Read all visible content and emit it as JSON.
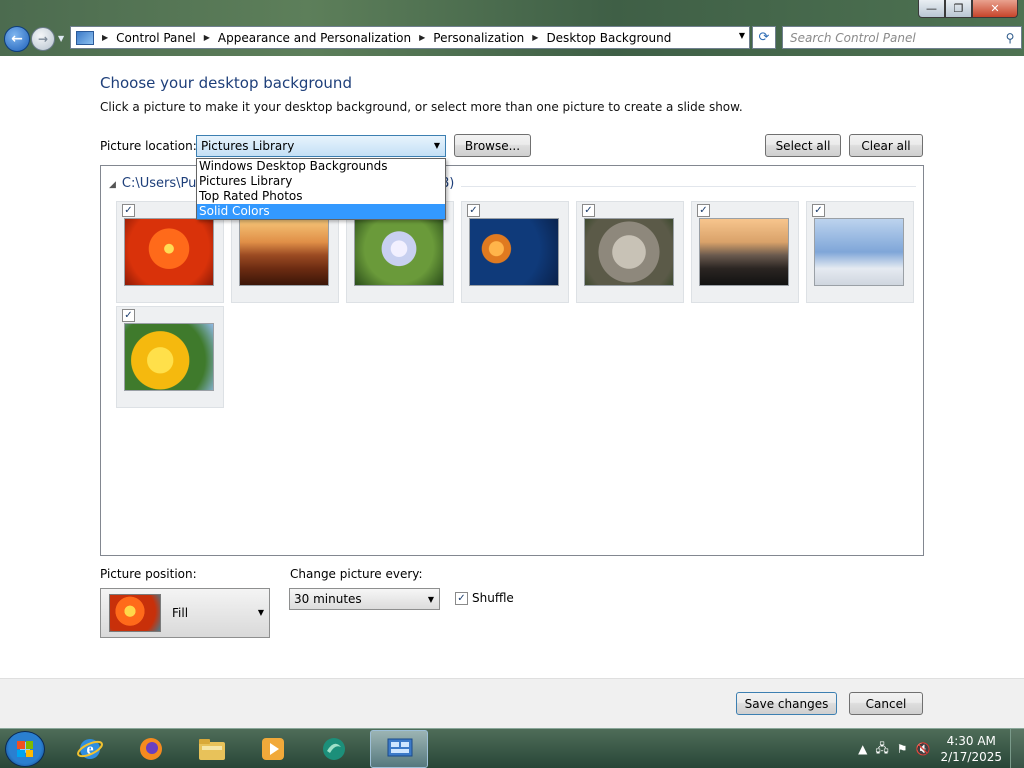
{
  "window": {
    "minimize_glyph": "—",
    "maximize_glyph": "❐",
    "close_glyph": "✕"
  },
  "nav": {
    "back_glyph": "←",
    "forward_glyph": "→"
  },
  "address_bar": {
    "breadcrumbs": [
      "Control Panel",
      "Appearance and Personalization",
      "Personalization",
      "Desktop Background"
    ]
  },
  "search": {
    "placeholder": "Search Control Panel"
  },
  "page": {
    "title": "Choose your desktop background",
    "description": "Click a picture to make it your desktop background, or select more than one picture to create a slide show."
  },
  "picture_location": {
    "label": "Picture location:",
    "value": "Pictures Library",
    "options": [
      "Windows Desktop Backgrounds",
      "Pictures Library",
      "Top Rated Photos",
      "Solid Colors"
    ],
    "highlighted": "Solid Colors"
  },
  "buttons": {
    "browse": "Browse...",
    "select_all": "Select all",
    "clear_all": "Clear all",
    "save": "Save changes",
    "cancel": "Cancel"
  },
  "gallery": {
    "group_title_visible": "C:\\Users\\Pu",
    "group_count_visible": "8)",
    "pictures": [
      {
        "name": "Chrysanthemum",
        "checked": true
      },
      {
        "name": "Desert",
        "checked": true
      },
      {
        "name": "Hydrangeas",
        "checked": true
      },
      {
        "name": "Jellyfish",
        "checked": true
      },
      {
        "name": "Koala",
        "checked": true
      },
      {
        "name": "Lighthouse",
        "checked": true
      },
      {
        "name": "Penguins",
        "checked": true
      },
      {
        "name": "Tulips",
        "checked": true
      }
    ]
  },
  "picture_position": {
    "label": "Picture position:",
    "value": "Fill"
  },
  "change_picture": {
    "label": "Change picture every:",
    "value": "30 minutes"
  },
  "shuffle": {
    "label": "Shuffle",
    "checked": true
  },
  "taskbar": {
    "time": "4:30 AM",
    "date": "2/17/2025"
  }
}
